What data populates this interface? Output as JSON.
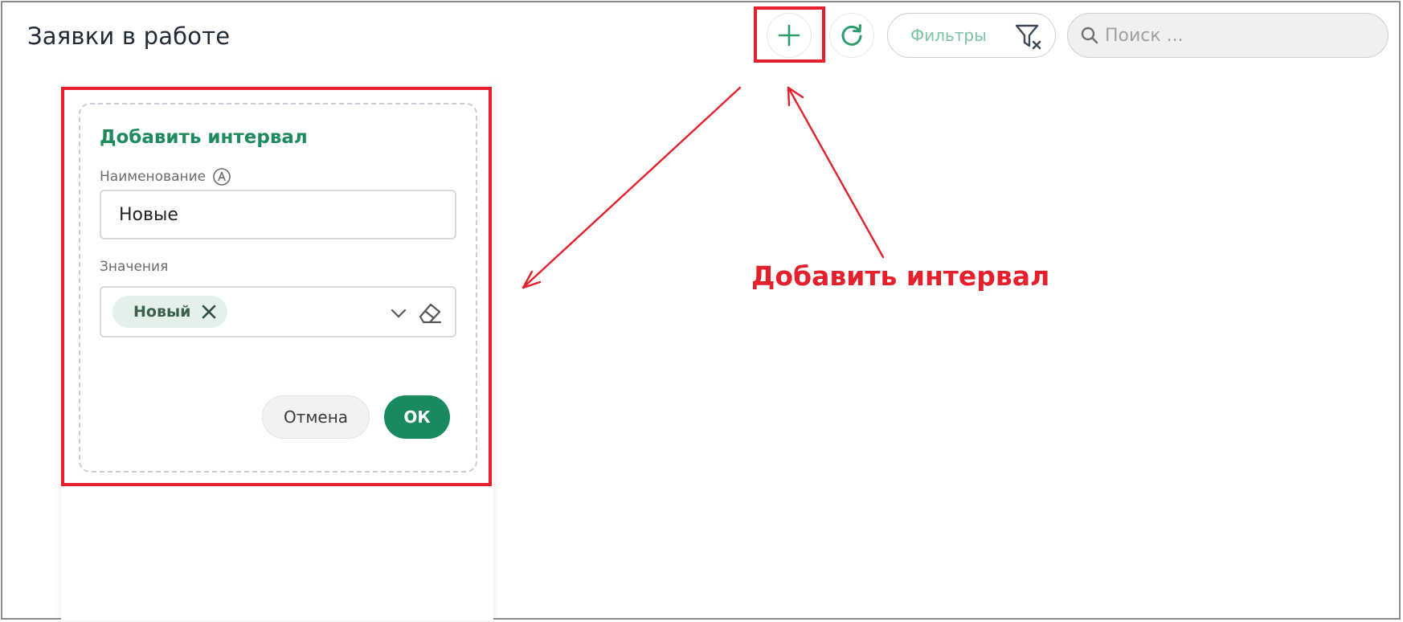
{
  "header": {
    "title": "Заявки в работе",
    "filter_label": "Фильтры",
    "search_placeholder": "Поиск ..."
  },
  "form": {
    "title": "Добавить интервал",
    "name_label": "Наименование",
    "name_value": "Новые",
    "values_label": "Значения",
    "selected_chips": [
      "Новый"
    ],
    "cancel_label": "Отмена",
    "ok_label": "ОК"
  },
  "annotation": {
    "text": "Добавить интервал"
  },
  "colors": {
    "accent_green": "#198a5e",
    "title_green": "#1f8a5c",
    "highlight_red": "#e3202b",
    "chip_bg": "#e3f1ea"
  },
  "icons": {
    "add": "plus-icon",
    "refresh": "refresh-icon",
    "filter": "filter-clear-icon",
    "search": "search-icon",
    "auto": "auto-letter-a-icon",
    "remove": "close-icon",
    "dropdown": "chevron-down-icon",
    "clear": "eraser-icon"
  }
}
